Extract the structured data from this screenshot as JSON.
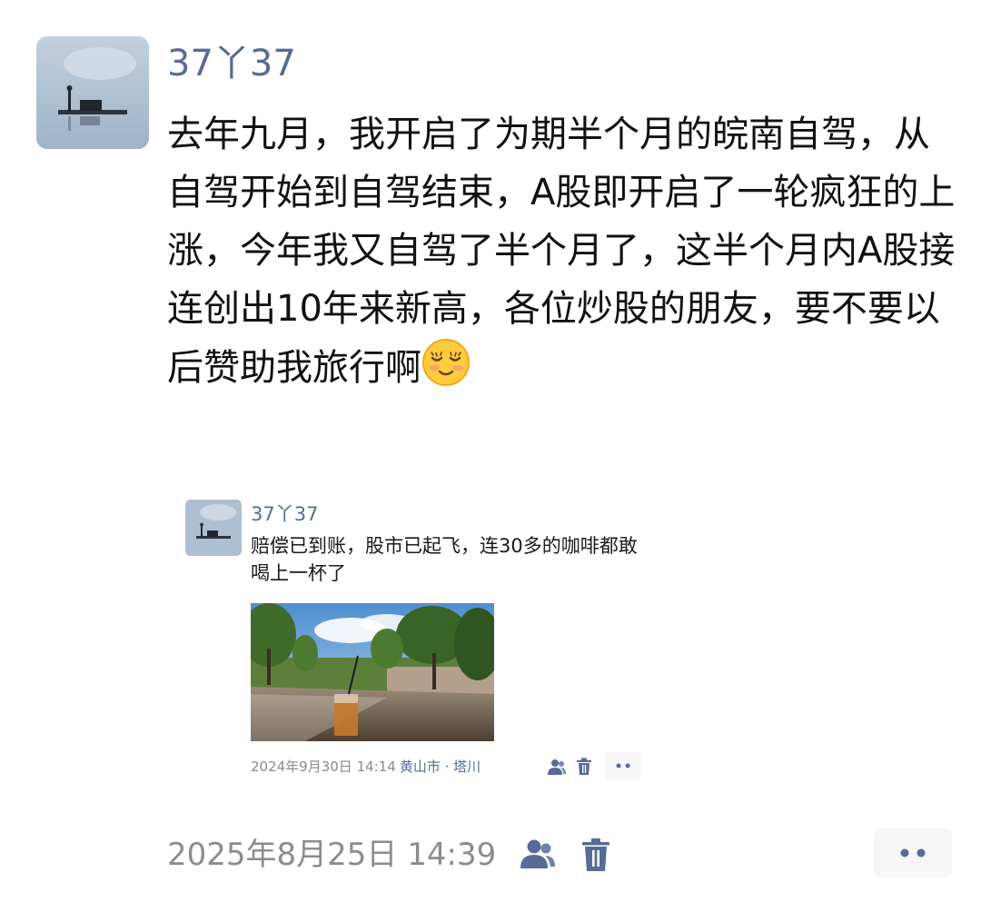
{
  "post": {
    "username": "37丫37",
    "text": "去年九月，我开启了为期半个月的皖南自驾，从自驾开始到自驾结束，A股即开启了一轮疯狂的上涨，今年我又自驾了半个月了，这半个月内A股接连创出10年来新高，各位炒股的朋友，要不要以后赞助我旅行啊",
    "emoji": "smiling-blushing-emoji",
    "timestamp": "2025年8月25日 14:39",
    "icons": [
      "people-icon",
      "trash-icon",
      "more-icon"
    ]
  },
  "shared_post": {
    "username": "37丫37",
    "text": "赔偿已到账，股市已起飞，连30多的咖啡都敢喝上一杯了",
    "timestamp": "2024年9月30日 14:14",
    "location": "黄山市 · 塔川",
    "icons": [
      "people-icon",
      "trash-icon",
      "more-icon"
    ]
  },
  "colors": {
    "link": "#576b95",
    "text": "#111111",
    "meta": "#8c8c8c",
    "button_bg": "#f7f7f7"
  }
}
